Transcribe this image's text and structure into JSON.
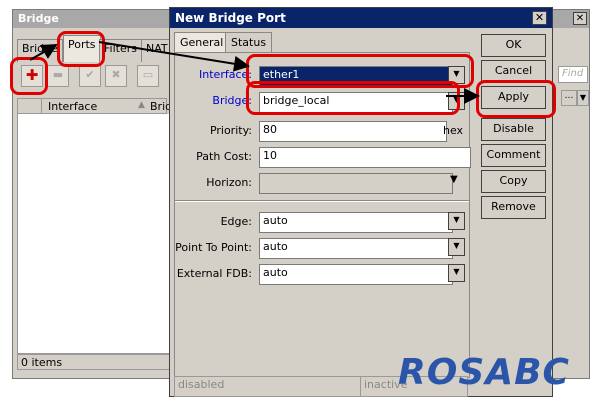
{
  "bridge_window": {
    "title": "Bridge",
    "tabs": [
      "Bridge",
      "Ports",
      "Filters",
      "NAT"
    ],
    "list_columns": [
      "Interface",
      "Bridge"
    ],
    "item_count": "0 items",
    "find_placeholder": "Find"
  },
  "dialog": {
    "title": "New Bridge Port",
    "close_glyph": "✕",
    "tabs": [
      "General",
      "Status"
    ],
    "fields": {
      "interface": {
        "label": "Interface:",
        "value": "ether1"
      },
      "bridge": {
        "label": "Bridge:",
        "value": "bridge_local"
      },
      "priority": {
        "label": "Priority:",
        "value": "80",
        "suffix": "hex"
      },
      "path_cost": {
        "label": "Path Cost:",
        "value": "10"
      },
      "horizon": {
        "label": "Horizon:",
        "value": ""
      },
      "edge": {
        "label": "Edge:",
        "value": "auto"
      },
      "point_to_point": {
        "label": "Point To Point:",
        "value": "auto"
      },
      "external_fdb": {
        "label": "External FDB:",
        "value": "auto"
      }
    },
    "buttons": [
      "OK",
      "Cancel",
      "Apply",
      "Disable",
      "Comment",
      "Copy",
      "Remove"
    ],
    "status": {
      "left": "disabled",
      "right": "inactive"
    }
  },
  "watermark": "ROSABC",
  "colors": {
    "highlight": "#e00000",
    "title_active": "#0a246a",
    "label_blue": "#0000cc"
  }
}
